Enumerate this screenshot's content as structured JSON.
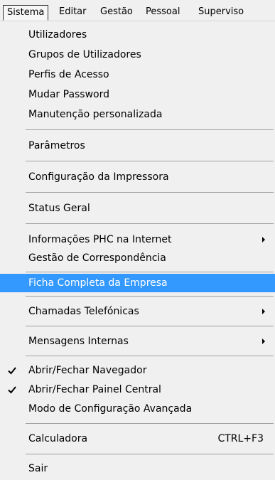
{
  "menubar": {
    "items": [
      {
        "label": "Sistema"
      },
      {
        "label": "Editar"
      },
      {
        "label": "Gestão"
      },
      {
        "label": "Pessoal"
      },
      {
        "label": "Superviso"
      }
    ]
  },
  "menu": {
    "items": [
      {
        "label": "Utilizadores"
      },
      {
        "label": "Grupos de Utilizadores"
      },
      {
        "label": "Perfis de Acesso"
      },
      {
        "label": "Mudar Password"
      },
      {
        "label": "Manutenção personalizada"
      },
      {
        "label": "Parâmetros"
      },
      {
        "label": "Configuração da Impressora"
      },
      {
        "label": "Status Geral"
      },
      {
        "label": "Informações PHC na Internet",
        "submenu": true
      },
      {
        "label": "Gestão de Correspondência"
      },
      {
        "label": "Ficha Completa da Empresa",
        "highlighted": true
      },
      {
        "label": "Chamadas Telefónicas",
        "submenu": true
      },
      {
        "label": "Mensagens Internas",
        "submenu": true
      },
      {
        "label": "Abrir/Fechar Navegador",
        "checked": true
      },
      {
        "label": "Abrir/Fechar Painel Central",
        "checked": true
      },
      {
        "label": "Modo de Configuração Avançada"
      },
      {
        "label": "Calculadora",
        "shortcut": "CTRL+F3"
      },
      {
        "label": "Sair"
      }
    ]
  },
  "colors": {
    "highlight": "#3399ff",
    "menu_background": "#f0f0f0",
    "separator": "#a0a0a0"
  }
}
